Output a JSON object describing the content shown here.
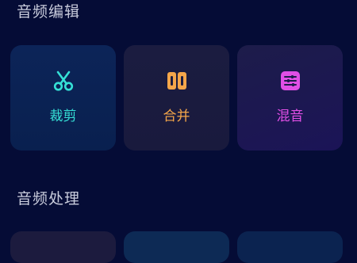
{
  "sections": {
    "edit": {
      "title": "音频编辑"
    },
    "process": {
      "title": "音频处理"
    }
  },
  "tools": [
    {
      "label": "裁剪",
      "icon": "scissors-icon",
      "color": "#35e0d6"
    },
    {
      "label": "合并",
      "icon": "merge-icon",
      "color": "#f4a64a"
    },
    {
      "label": "混音",
      "icon": "mixer-icon",
      "color": "#e14fe6"
    }
  ]
}
